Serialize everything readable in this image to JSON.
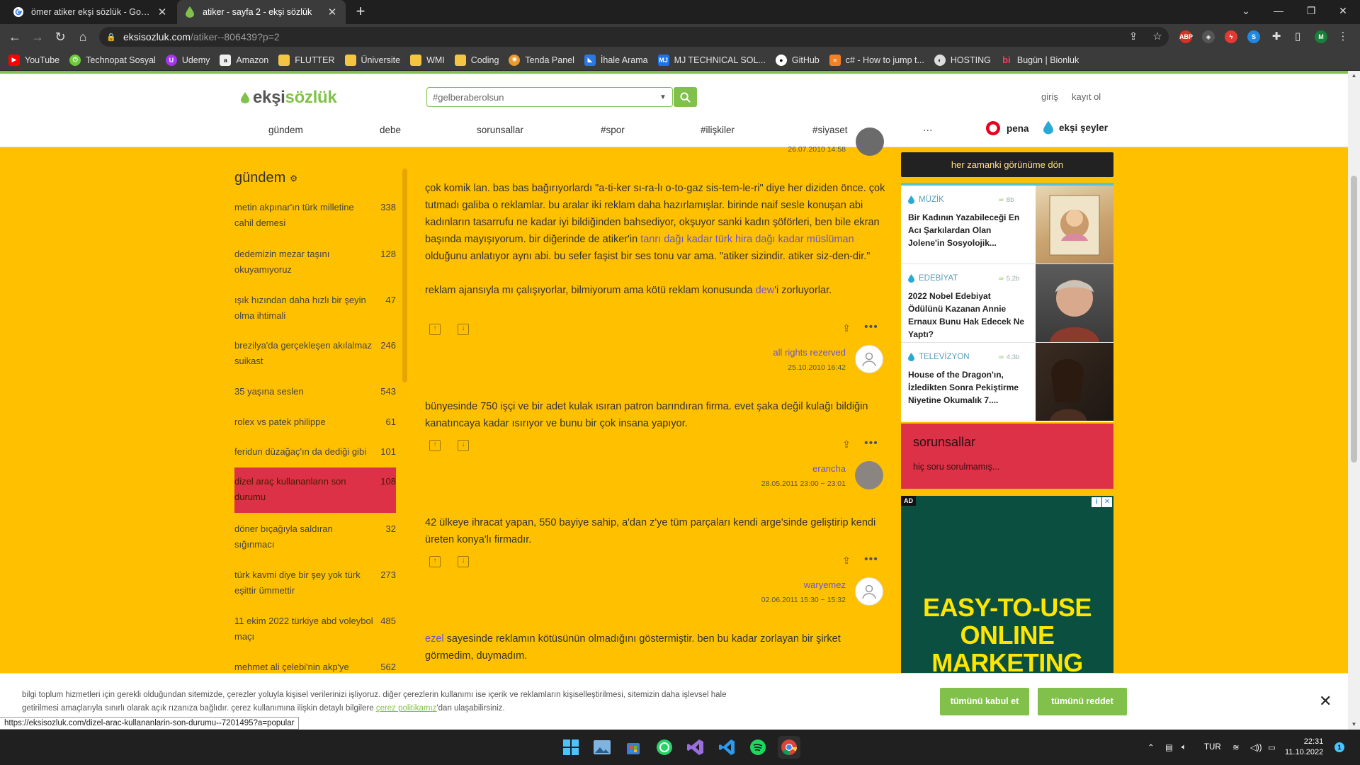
{
  "browser": {
    "tabs": [
      {
        "title": "ömer atiker ekşi sözlük - Google Ara",
        "active": false
      },
      {
        "title": "atiker - sayfa 2 - ekşi sözlük",
        "active": true
      }
    ],
    "url_host": "eksisozluk.com",
    "url_path": "/atiker--806439?p=2",
    "bookmarks": [
      {
        "label": "YouTube",
        "icon": "youtube-icon",
        "color": "#ff0000"
      },
      {
        "label": "Technopat Sosyal",
        "icon": "power-icon",
        "color": "#6ecb3c"
      },
      {
        "label": "Udemy",
        "icon": "udemy-icon",
        "color": "#a435f0"
      },
      {
        "label": "Amazon",
        "icon": "amazon-icon",
        "color": "#eeeeee"
      },
      {
        "label": "FLUTTER",
        "icon": "folder-icon",
        "color": "#f4c542"
      },
      {
        "label": "Üniversite",
        "icon": "folder-icon",
        "color": "#f4c542"
      },
      {
        "label": "WMI",
        "icon": "folder-icon",
        "color": "#f4c542"
      },
      {
        "label": "Coding",
        "icon": "folder-icon",
        "color": "#f4c542"
      },
      {
        "label": "Tenda Panel",
        "icon": "gear-icon",
        "color": "#e89b2e"
      },
      {
        "label": "İhale Arama",
        "icon": "ihale-icon",
        "color": "#2b78e4"
      },
      {
        "label": "MJ TECHNICAL SOL...",
        "icon": "mj-icon",
        "color": "#1a73e8"
      },
      {
        "label": "GitHub",
        "icon": "github-icon",
        "color": "#ffffff"
      },
      {
        "label": "c# - How to jump t...",
        "icon": "stackoverflow-icon",
        "color": "#f48024"
      },
      {
        "label": "HOSTING",
        "icon": "hosting-icon",
        "color": "#dddddd"
      },
      {
        "label": "Bugün | Bionluk",
        "icon": "bionluk-icon",
        "color": "#ff3b5c"
      }
    ]
  },
  "site": {
    "logo_part1": "ekşi",
    "logo_part2": "sözlük",
    "search_value": "#gelberaberolsun",
    "login": "giriş",
    "register": "kayıt ol",
    "nav": [
      "gündem",
      "debe",
      "sorunsallar",
      "#spor",
      "#ilişkiler",
      "#siyaset",
      "···"
    ],
    "pena": "pena",
    "eksi_seyler": "ekşi şeyler",
    "colors": {
      "brand": "#81c14b",
      "background": "#ffc000",
      "selected": "#dc3147",
      "link": "#6b52d6"
    }
  },
  "sidebar": {
    "title": "gündem",
    "topics": [
      {
        "title": "metin akpınar'ın türk milletine cahil demesi",
        "count": "338"
      },
      {
        "title": "dedemizin mezar taşını okuyamıyoruz",
        "count": "128"
      },
      {
        "title": "ışık hızından daha hızlı bir şeyin olma ihtimali",
        "count": "47"
      },
      {
        "title": "brezilya'da gerçekleşen akılalmaz suikast",
        "count": "246"
      },
      {
        "title": "35 yaşına seslen",
        "count": "543"
      },
      {
        "title": "rolex vs patek philippe",
        "count": "61"
      },
      {
        "title": "feridun düzağaç'ın da dediği gibi",
        "count": "101"
      },
      {
        "title": "dizel araç kullananların son durumu",
        "count": "108",
        "selected": true
      },
      {
        "title": "döner bıçağıyla saldıran sığınmacı",
        "count": "32"
      },
      {
        "title": "türk kavmi diye bir şey yok türk eşittir ümmettir",
        "count": "273"
      },
      {
        "title": "11 ekim 2022 türkiye abd voleybol maçı",
        "count": "485"
      },
      {
        "title": "mehmet ali çelebi'nin akp'ye",
        "count": "562"
      }
    ]
  },
  "entries": {
    "prev_date": "26.07.2010 14:58",
    "e1_p1_before": "çok komik lan. bas bas bağırıyorlardı \"a-ti-ker sı-ra-lı o-to-gaz sis-tem-le-ri\" diye her diziden önce. çok tutmadı galiba o reklamlar. bu aralar iki reklam daha hazırlamışlar. birinde naif sesle konuşan abi kadınların tasarrufu ne kadar iyi bildiğinden bahsediyor, okşuyor sanki kadın şöförleri, ben bile ekran başında mayışıyorum. bir diğerinde de atiker'in ",
    "e1_link": "tanrı dağı kadar türk hira dağı kadar müslüman",
    "e1_p1_after": " olduğunu anlatıyor aynı abi. bu sefer faşist bir ses tonu var ama. \"atiker sizindir. atiker siz-den-dir.\"",
    "e1_p2_before": "reklam ajansıyla mı çalışıyorlar, bilmiyorum ama kötü reklam konusunda ",
    "e1_p2_link": "dew",
    "e1_p2_after": "'i zorluyorlar.",
    "e1_author": "all rights rezerved",
    "e1_date": "25.10.2010 16:42",
    "e2_text": "bünyesinde 750 işçi ve bir adet kulak ısıran patron barındıran firma. evet şaka değil kulağı bildiğin kanatıncaya kadar ısırıyor ve bunu bir çok insana yapıyor.",
    "e2_author": "erancha",
    "e2_date": "28.05.2011 23:00 ~ 23:01",
    "e3_text": "42 ülkeye ihracat yapan, 550 bayiye sahip, a'dan z'ye tüm parçaları kendi arge'sinde geliştirip kendi üreten konya'lı firmadır.",
    "e3_author": "waryemez",
    "e3_date": "02.06.2011 15:30 ~ 15:32",
    "e4_link": "ezel",
    "e4_after": " sayesinde reklamın kötüsünün olmadığını göstermiştir. ben bu kadar zorlayan bir şirket görmedim, duymadım."
  },
  "right": {
    "old_view": "her zamanki görünüme dön",
    "cards": [
      {
        "category": "MÜZİK",
        "views": "8b",
        "headline": "Bir Kadının Yazabileceği En Acı Şarkılardan Olan Jolene'in Sosyolojik..."
      },
      {
        "category": "EDEBİYAT",
        "views": "5,2b",
        "headline": "2022 Nobel Edebiyat Ödülünü Kazanan Annie Ernaux Bunu Hak Edecek Ne Yaptı?"
      },
      {
        "category": "TELEVİZYON",
        "views": "4,3b",
        "headline": "House of the Dragon'ın, İzledikten Sonra Pekiştirme Niyetine Okumalık 7...."
      }
    ],
    "sorunsallar_title": "sorunsallar",
    "sorunsallar_empty": "hiç soru sorulmamış...",
    "ad_tag": "AD",
    "ad_line1": "EASY-TO-USE",
    "ad_line2": "ONLINE",
    "ad_line3": "MARKETING"
  },
  "cookie": {
    "text_1": "bilgi toplum hizmetleri için gerekli olduğundan sitemizde, çerezler yoluyla kişisel verilerinizi işliyoruz. diğer çerezlerin kullanımı ise içerik ve reklamların kişiselleştirilmesi, sitemizin daha işlevsel hale getirilmesi amaçlarıyla sınırlı olarak açık rızanıza bağlıdır. çerez kullanımına ilişkin detaylı bilgilere ",
    "link": "çerez politikamız",
    "text_2": "'dan ulaşabilirsiniz.",
    "accept": "tümünü kabul et",
    "reject": "tümünü reddet"
  },
  "status_url": "https://eksisozluk.com/dizel-arac-kullananlarin-son-durumu--7201495?a=popular",
  "taskbar": {
    "lang": "TUR",
    "time": "22:31",
    "date": "11.10.2022",
    "notifications": "1"
  }
}
